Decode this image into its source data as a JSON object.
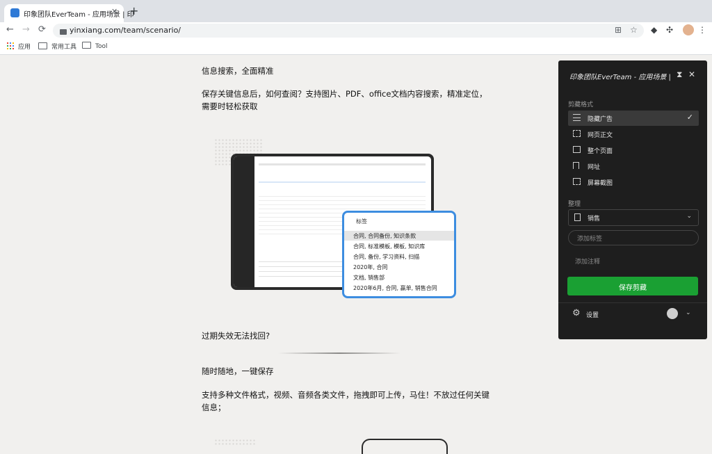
{
  "browser": {
    "tab_title": "印象团队EverTeam - 应用场景 | 印",
    "tab_close": "✕",
    "new_tab": "+",
    "url": "yinxiang.com/team/scenario/",
    "bookmarks": [
      "应用",
      "常用工具",
      "Tool"
    ]
  },
  "article": {
    "heading1": "信息搜索，全面精准",
    "para1_line1": "保存关键信息后，如何查阅？支持图片、PDF、office文档内容搜索，精准定位，",
    "para1_line2": "需要时轻松获取",
    "heading2": "过期失效无法找回?",
    "heading3": "随时随地，一键保存",
    "para2_line1": "支持多种文件格式，视频、音频各类文件，拖拽即可上传，马住！不放过任何关键",
    "para2_line2": "信息；"
  },
  "illustration": {
    "tag_header": "标签",
    "tags": [
      "合同, 合同备份, 知识条款",
      "合同, 标准模板, 模板, 知识库",
      "合同, 备份, 学习资料, 扫描",
      "2020年, 合同",
      "文档, 销售部",
      "2020年6月, 合同, 赢单, 销售合同"
    ]
  },
  "clipper": {
    "title": "印象团队EverTeam - 应用场景 | 印",
    "format_label": "剪藏格式",
    "options": [
      {
        "label": "隐藏广告",
        "selected": true,
        "icon": "hide-ads-icon"
      },
      {
        "label": "网页正文",
        "selected": false,
        "icon": "article-icon"
      },
      {
        "label": "整个页面",
        "selected": false,
        "icon": "full-page-icon"
      },
      {
        "label": "网址",
        "selected": false,
        "icon": "bookmark-icon"
      },
      {
        "label": "屏幕截图",
        "selected": false,
        "icon": "screenshot-icon"
      }
    ],
    "organize_label": "整理",
    "notebook": "销售",
    "tag_placeholder": "添加标签",
    "note_placeholder": "添加注释",
    "save_button": "保存剪藏",
    "settings": "设置"
  },
  "colors": {
    "accent_green": "#1aa033",
    "popup_blue": "#3d8de0",
    "clipper_bg": "#1e1e1e"
  }
}
